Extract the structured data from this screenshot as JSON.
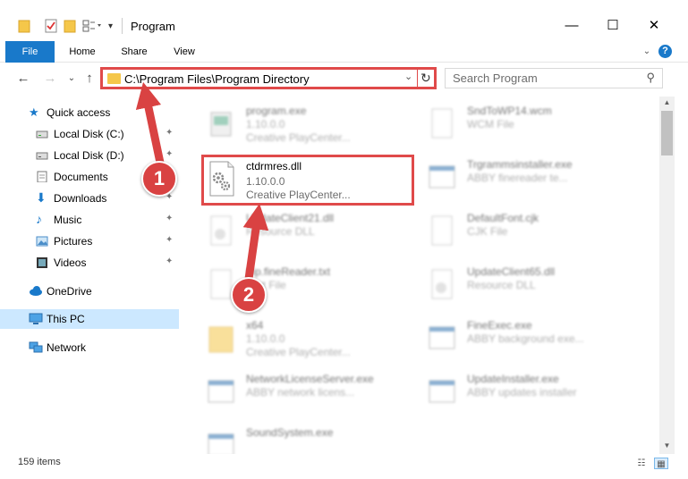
{
  "window": {
    "title": "Program",
    "minimize": "—",
    "maximize": "☐",
    "close": "✕"
  },
  "ribbon": {
    "tabs": [
      "File",
      "Home",
      "Share",
      "View"
    ],
    "expand": "⌄",
    "help": "?"
  },
  "nav": {
    "back": "←",
    "forward": "→",
    "recent": "⌄",
    "up": "↑",
    "address": "C:\\Program Files\\Program Directory",
    "address_dropdown": "⌄",
    "refresh": "↻",
    "search_placeholder": "Search Program",
    "search_glyph": "⚲"
  },
  "sidebar": {
    "items": [
      {
        "label": "Quick access",
        "icon": "star-icon",
        "pinned": false
      },
      {
        "label": "Local Disk (C:)",
        "icon": "drive-icon",
        "pinned": true
      },
      {
        "label": "Local Disk (D:)",
        "icon": "drive-icon",
        "pinned": true
      },
      {
        "label": "Documents",
        "icon": "documents-icon",
        "pinned": true
      },
      {
        "label": "Downloads",
        "icon": "download-icon",
        "pinned": true
      },
      {
        "label": "Music",
        "icon": "music-icon",
        "pinned": true
      },
      {
        "label": "Pictures",
        "icon": "pictures-icon",
        "pinned": true
      },
      {
        "label": "Videos",
        "icon": "videos-icon",
        "pinned": true
      },
      {
        "label": "OneDrive",
        "icon": "cloud-icon",
        "pinned": false
      },
      {
        "label": "This PC",
        "icon": "computer-icon",
        "pinned": false,
        "selected": true
      },
      {
        "label": "Network",
        "icon": "network-icon",
        "pinned": false
      }
    ],
    "pin_glyph": "📌"
  },
  "files": {
    "left": [
      {
        "name": "program.exe",
        "line1": "1.10.0.0",
        "line2": "Creative PlayCenter..."
      },
      {
        "name": "ctdrmres.dll",
        "line1": "1.10.0.0",
        "line2": "Creative PlayCenter..."
      },
      {
        "name": "UpdateClient21.dll",
        "line1": "Resource DLL",
        "line2": ""
      },
      {
        "name": "trip.fineReader.txt",
        "line1": "Text File",
        "line2": ""
      },
      {
        "name": "x64",
        "line1": "1.10.0.0",
        "line2": "Creative PlayCenter..."
      },
      {
        "name": "NetworkLicenseServer.exe",
        "line1": "ABBY network licens...",
        "line2": ""
      },
      {
        "name": "SoundSystem.exe",
        "line1": "",
        "line2": ""
      }
    ],
    "right": [
      {
        "name": "SndToWP14.wcm",
        "line1": "WCM File"
      },
      {
        "name": "Trgrammsinstaller.exe",
        "line1": "ABBY finereader te..."
      },
      {
        "name": "DefaultFont.cjk",
        "line1": "CJK File"
      },
      {
        "name": "UpdateClient65.dll",
        "line1": "Resource DLL"
      },
      {
        "name": "FineExec.exe",
        "line1": "ABBY background exe..."
      },
      {
        "name": "UpdateInstaller.exe",
        "line1": "ABBY updates installer"
      }
    ]
  },
  "status": {
    "count": "159 items"
  },
  "annotations": {
    "step1": "1",
    "step2": "2",
    "accent": "#d94242"
  },
  "colors": {
    "file_tab": "#1979ca",
    "highlight": "#e04a4a",
    "selection": "#cce8ff",
    "folder": "#f5c74a"
  }
}
